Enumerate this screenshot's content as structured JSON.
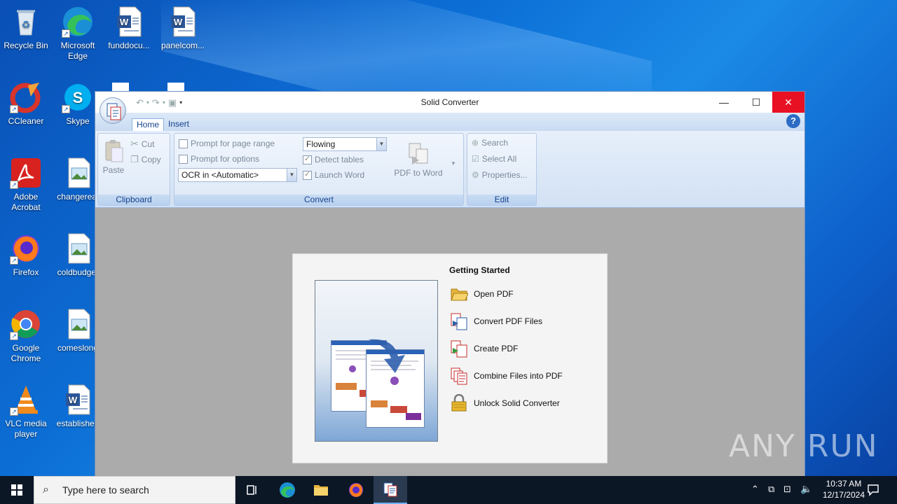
{
  "desktop": {
    "icons": [
      {
        "label": "Recycle Bin",
        "icon": "recycle-bin-icon"
      },
      {
        "label": "Microsoft Edge",
        "icon": "edge-icon"
      },
      {
        "label": "funddocu...",
        "icon": "word-doc-icon"
      },
      {
        "label": "panelcom...",
        "icon": "word-doc-icon"
      },
      {
        "label": "CCleaner",
        "icon": "ccleaner-icon"
      },
      {
        "label": "Skype",
        "icon": "skype-icon"
      },
      {
        "label": "Adobe Acrobat",
        "icon": "acrobat-icon"
      },
      {
        "label": "changereal",
        "icon": "image-file-icon"
      },
      {
        "label": "Firefox",
        "icon": "firefox-icon"
      },
      {
        "label": "coldbudget",
        "icon": "image-file-icon"
      },
      {
        "label": "Google Chrome",
        "icon": "chrome-icon"
      },
      {
        "label": "comeslong",
        "icon": "image-file-icon"
      },
      {
        "label": "VLC media player",
        "icon": "vlc-icon"
      },
      {
        "label": "established",
        "icon": "word-doc-icon"
      }
    ]
  },
  "window": {
    "title": "Solid Converter",
    "controls": {
      "minimize": "—",
      "maximize": "☐",
      "close": "✕"
    },
    "tabs": [
      "Home",
      "Insert"
    ],
    "help": "?"
  },
  "ribbon": {
    "clipboard": {
      "name": "Clipboard",
      "paste": "Paste",
      "cut": "Cut",
      "copy": "Copy"
    },
    "convert": {
      "name": "Convert",
      "prompt_page_range": "Prompt for page range",
      "prompt_options": "Prompt for options",
      "ocr_value": "OCR in <Automatic>",
      "layout_value": "Flowing",
      "detect_tables": "Detect tables",
      "launch_word": "Launch Word",
      "pdf_to_word": "PDF to Word"
    },
    "edit": {
      "name": "Edit",
      "search": "Search",
      "select_all": "Select All",
      "properties": "Properties..."
    }
  },
  "getting_started": {
    "title": "Getting Started",
    "items": [
      {
        "label": "Open PDF",
        "icon": "folder-icon"
      },
      {
        "label": "Convert PDF Files",
        "icon": "convert-pdf-icon"
      },
      {
        "label": "Create PDF",
        "icon": "create-pdf-icon"
      },
      {
        "label": "Combine Files into PDF",
        "icon": "combine-pdf-icon"
      },
      {
        "label": "Unlock Solid Converter",
        "icon": "lock-icon"
      }
    ]
  },
  "taskbar": {
    "search_placeholder": "Type here to search",
    "time": "10:37 AM",
    "date": "12/17/2024"
  },
  "watermark": "ANY RUN"
}
